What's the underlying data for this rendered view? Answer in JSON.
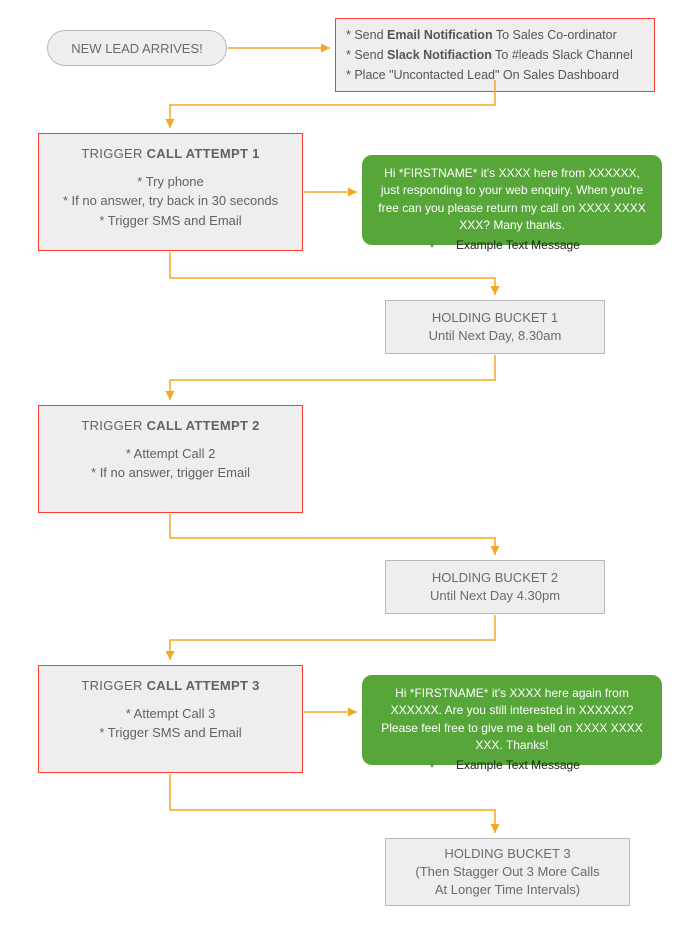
{
  "start": {
    "label": "NEW LEAD ARRIVES!"
  },
  "notif": {
    "row1_pre": "Send ",
    "row1_bold": "Email Notification",
    "row1_post": " To Sales Co-ordinator",
    "row2_pre": "Send ",
    "row2_bold": "Slack Notifiaction",
    "row2_post": " To #leads Slack Channel",
    "row3": "Place \"Uncontacted Lead\" On Sales Dashboard"
  },
  "call1": {
    "title_pre": "TRIGGER ",
    "title_bold": "CALL ATTEMPT 1",
    "b1": "Try phone",
    "b2": "If no answer, try back in 30 seconds",
    "b3": "Trigger SMS and Email"
  },
  "msg1": {
    "text": "Hi *FIRSTNAME* it's XXXX here from XXXXXX, just responding to your web enquiry.  When you're free can you please return my call on XXXX XXXX XXX? Many thanks.",
    "caption": "Example Text Message"
  },
  "hold1": {
    "line1": "HOLDING BUCKET 1",
    "line2": "Until Next Day, 8.30am"
  },
  "call2": {
    "title_pre": "TRIGGER ",
    "title_bold": "CALL ATTEMPT 2",
    "b1": "Attempt Call 2",
    "b2": "If no answer, trigger Email"
  },
  "hold2": {
    "line1": "HOLDING BUCKET 2",
    "line2": "Until Next Day 4.30pm"
  },
  "call3": {
    "title_pre": "TRIGGER ",
    "title_bold": "CALL ATTEMPT 3",
    "b1": "Attempt Call 3",
    "b2": "Trigger SMS and Email"
  },
  "msg3": {
    "text": "Hi *FIRSTNAME* it's XXXX here again from XXXXXX. Are you still interested in XXXXXX? Please feel free to give me a bell on XXXX XXXX XXX. Thanks!",
    "caption": "Example Text Message"
  },
  "hold3": {
    "line1": "HOLDING BUCKET 3",
    "line2": "(Then Stagger Out 3 More Calls",
    "line3": "At Longer Time Intervals)"
  },
  "colors": {
    "arrow": "#f5a623",
    "arrow2": "#f5a623"
  }
}
